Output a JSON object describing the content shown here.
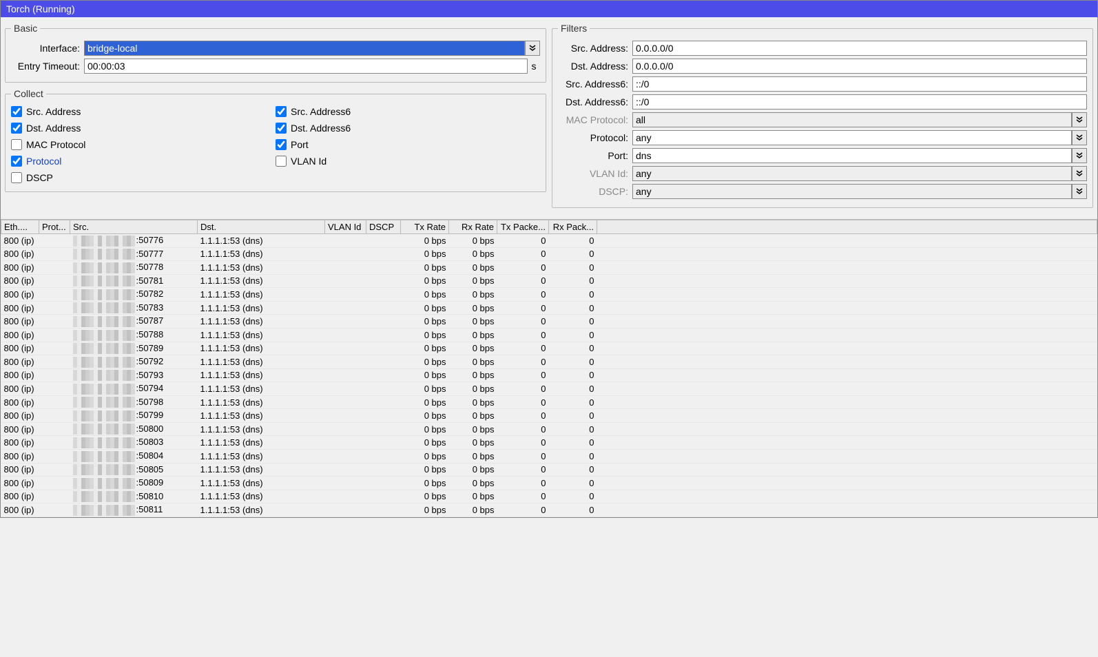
{
  "window": {
    "title": "Torch (Running)"
  },
  "basic": {
    "legend": "Basic",
    "interface_label": "Interface:",
    "interface_value": "bridge-local",
    "timeout_label": "Entry Timeout:",
    "timeout_value": "00:00:03",
    "timeout_unit": "s"
  },
  "collect": {
    "legend": "Collect",
    "src_address": "Src. Address",
    "dst_address": "Dst. Address",
    "mac_protocol": "MAC Protocol",
    "protocol": "Protocol",
    "dscp": "DSCP",
    "src_address6": "Src. Address6",
    "dst_address6": "Dst. Address6",
    "port": "Port",
    "vlan_id": "VLAN Id"
  },
  "filters": {
    "legend": "Filters",
    "src_addr_label": "Src. Address:",
    "src_addr_value": "0.0.0.0/0",
    "dst_addr_label": "Dst. Address:",
    "dst_addr_value": "0.0.0.0/0",
    "src_addr6_label": "Src. Address6:",
    "src_addr6_value": "::/0",
    "dst_addr6_label": "Dst. Address6:",
    "dst_addr6_value": "::/0",
    "mac_proto_label": "MAC Protocol:",
    "mac_proto_value": "all",
    "proto_label": "Protocol:",
    "proto_value": "any",
    "port_label": "Port:",
    "port_value": "dns",
    "vlan_label": "VLAN Id:",
    "vlan_value": "any",
    "dscp_label": "DSCP:",
    "dscp_value": "any"
  },
  "table": {
    "columns": {
      "eth": "Eth....",
      "prot": "Prot...",
      "src": "Src.",
      "dst": "Dst.",
      "vlan": "VLAN Id",
      "dscp": "DSCP",
      "tx_rate": "Tx Rate",
      "rx_rate": "Rx Rate",
      "tx_pkt": "Tx Packe...",
      "rx_pkt": "Rx Pack..."
    },
    "rows": [
      {
        "eth": "800 (ip)",
        "prot": "",
        "src": ":50776",
        "dst": "1.1.1.1:53 (dns)",
        "vlan": "",
        "dscp": "",
        "tx": "0 bps",
        "rx": "0 bps",
        "txp": "0",
        "rxp": "0"
      },
      {
        "eth": "800 (ip)",
        "prot": "",
        "src": ":50777",
        "dst": "1.1.1.1:53 (dns)",
        "vlan": "",
        "dscp": "",
        "tx": "0 bps",
        "rx": "0 bps",
        "txp": "0",
        "rxp": "0"
      },
      {
        "eth": "800 (ip)",
        "prot": "",
        "src": ":50778",
        "dst": "1.1.1.1:53 (dns)",
        "vlan": "",
        "dscp": "",
        "tx": "0 bps",
        "rx": "0 bps",
        "txp": "0",
        "rxp": "0"
      },
      {
        "eth": "800 (ip)",
        "prot": "",
        "src": ":50781",
        "dst": "1.1.1.1:53 (dns)",
        "vlan": "",
        "dscp": "",
        "tx": "0 bps",
        "rx": "0 bps",
        "txp": "0",
        "rxp": "0"
      },
      {
        "eth": "800 (ip)",
        "prot": "",
        "src": ":50782",
        "dst": "1.1.1.1:53 (dns)",
        "vlan": "",
        "dscp": "",
        "tx": "0 bps",
        "rx": "0 bps",
        "txp": "0",
        "rxp": "0"
      },
      {
        "eth": "800 (ip)",
        "prot": "",
        "src": ":50783",
        "dst": "1.1.1.1:53 (dns)",
        "vlan": "",
        "dscp": "",
        "tx": "0 bps",
        "rx": "0 bps",
        "txp": "0",
        "rxp": "0"
      },
      {
        "eth": "800 (ip)",
        "prot": "",
        "src": ":50787",
        "dst": "1.1.1.1:53 (dns)",
        "vlan": "",
        "dscp": "",
        "tx": "0 bps",
        "rx": "0 bps",
        "txp": "0",
        "rxp": "0"
      },
      {
        "eth": "800 (ip)",
        "prot": "",
        "src": ":50788",
        "dst": "1.1.1.1:53 (dns)",
        "vlan": "",
        "dscp": "",
        "tx": "0 bps",
        "rx": "0 bps",
        "txp": "0",
        "rxp": "0"
      },
      {
        "eth": "800 (ip)",
        "prot": "",
        "src": ":50789",
        "dst": "1.1.1.1:53 (dns)",
        "vlan": "",
        "dscp": "",
        "tx": "0 bps",
        "rx": "0 bps",
        "txp": "0",
        "rxp": "0"
      },
      {
        "eth": "800 (ip)",
        "prot": "",
        "src": ":50792",
        "dst": "1.1.1.1:53 (dns)",
        "vlan": "",
        "dscp": "",
        "tx": "0 bps",
        "rx": "0 bps",
        "txp": "0",
        "rxp": "0"
      },
      {
        "eth": "800 (ip)",
        "prot": "",
        "src": ":50793",
        "dst": "1.1.1.1:53 (dns)",
        "vlan": "",
        "dscp": "",
        "tx": "0 bps",
        "rx": "0 bps",
        "txp": "0",
        "rxp": "0"
      },
      {
        "eth": "800 (ip)",
        "prot": "",
        "src": ":50794",
        "dst": "1.1.1.1:53 (dns)",
        "vlan": "",
        "dscp": "",
        "tx": "0 bps",
        "rx": "0 bps",
        "txp": "0",
        "rxp": "0"
      },
      {
        "eth": "800 (ip)",
        "prot": "",
        "src": ":50798",
        "dst": "1.1.1.1:53 (dns)",
        "vlan": "",
        "dscp": "",
        "tx": "0 bps",
        "rx": "0 bps",
        "txp": "0",
        "rxp": "0"
      },
      {
        "eth": "800 (ip)",
        "prot": "",
        "src": ":50799",
        "dst": "1.1.1.1:53 (dns)",
        "vlan": "",
        "dscp": "",
        "tx": "0 bps",
        "rx": "0 bps",
        "txp": "0",
        "rxp": "0"
      },
      {
        "eth": "800 (ip)",
        "prot": "",
        "src": ":50800",
        "dst": "1.1.1.1:53 (dns)",
        "vlan": "",
        "dscp": "",
        "tx": "0 bps",
        "rx": "0 bps",
        "txp": "0",
        "rxp": "0"
      },
      {
        "eth": "800 (ip)",
        "prot": "",
        "src": ":50803",
        "dst": "1.1.1.1:53 (dns)",
        "vlan": "",
        "dscp": "",
        "tx": "0 bps",
        "rx": "0 bps",
        "txp": "0",
        "rxp": "0"
      },
      {
        "eth": "800 (ip)",
        "prot": "",
        "src": ":50804",
        "dst": "1.1.1.1:53 (dns)",
        "vlan": "",
        "dscp": "",
        "tx": "0 bps",
        "rx": "0 bps",
        "txp": "0",
        "rxp": "0"
      },
      {
        "eth": "800 (ip)",
        "prot": "",
        "src": ":50805",
        "dst": "1.1.1.1:53 (dns)",
        "vlan": "",
        "dscp": "",
        "tx": "0 bps",
        "rx": "0 bps",
        "txp": "0",
        "rxp": "0"
      },
      {
        "eth": "800 (ip)",
        "prot": "",
        "src": ":50809",
        "dst": "1.1.1.1:53 (dns)",
        "vlan": "",
        "dscp": "",
        "tx": "0 bps",
        "rx": "0 bps",
        "txp": "0",
        "rxp": "0"
      },
      {
        "eth": "800 (ip)",
        "prot": "",
        "src": ":50810",
        "dst": "1.1.1.1:53 (dns)",
        "vlan": "",
        "dscp": "",
        "tx": "0 bps",
        "rx": "0 bps",
        "txp": "0",
        "rxp": "0"
      },
      {
        "eth": "800 (ip)",
        "prot": "",
        "src": ":50811",
        "dst": "1.1.1.1:53 (dns)",
        "vlan": "",
        "dscp": "",
        "tx": "0 bps",
        "rx": "0 bps",
        "txp": "0",
        "rxp": "0"
      }
    ]
  }
}
